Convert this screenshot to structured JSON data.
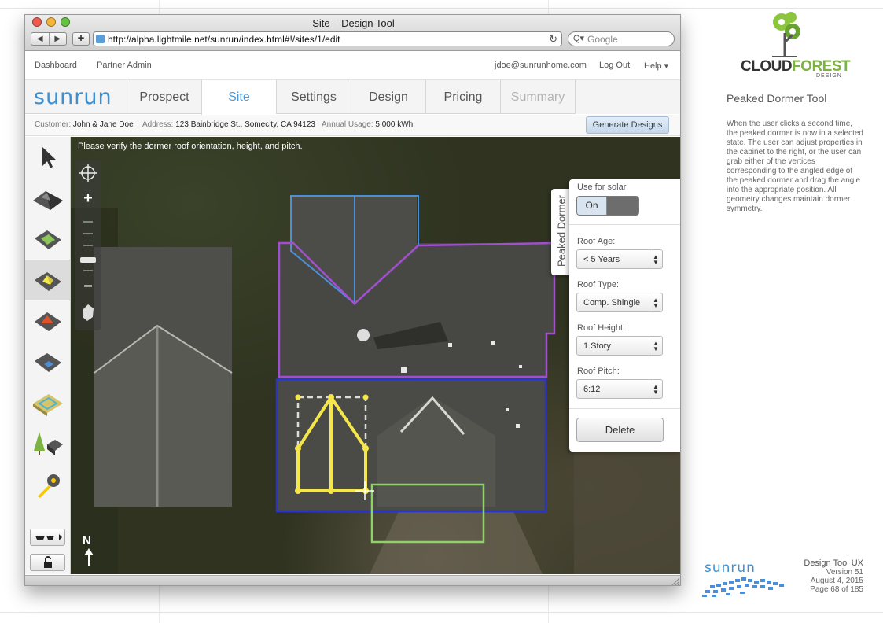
{
  "browser": {
    "title": "Site – Design Tool",
    "url": "http://alpha.lightmile.net/sunrun/index.html#!/sites/1/edit",
    "search_placeholder": "Google",
    "back_glyph": "◀",
    "forward_glyph": "▶",
    "add_glyph": "+",
    "reload_glyph": "↻",
    "search_glyph": "Q▾"
  },
  "usernav": {
    "dashboard": "Dashboard",
    "partner_admin": "Partner Admin",
    "email": "jdoe@sunrunhome.com",
    "logout": "Log Out",
    "help": "Help ▾"
  },
  "app": {
    "logo": "sunrun",
    "brand_color": "#3d8fd0",
    "tabs": [
      {
        "label": "Prospect"
      },
      {
        "label": "Site"
      },
      {
        "label": "Settings"
      },
      {
        "label": "Design"
      },
      {
        "label": "Pricing"
      },
      {
        "label": "Summary"
      }
    ],
    "active_tab": "Site",
    "disabled_tab": "Summary"
  },
  "info": {
    "customer_label": "Customer:",
    "customer_value": "John & Jane Doe",
    "address_label": "Address:",
    "address_value": "123 Bainbridge St., Somecity, CA 94123",
    "usage_label": "Annual Usage:",
    "usage_value": "5,000 kWh",
    "generate_button": "Generate Designs"
  },
  "toolbar": {
    "tools": [
      "pointer-icon",
      "peaked-roof-icon",
      "flat-roof-icon",
      "peaked-dormer-icon",
      "hip-roof-icon",
      "shed-dormer-icon",
      "flat-plane-icon",
      "tree-obstruction-icon",
      "tape-measure-icon"
    ],
    "selected_tool": "peaked-dormer-icon"
  },
  "map": {
    "message": "Please verify the dormer roof orientation, height, and pitch.",
    "north_label": "N",
    "zoom_in": "+",
    "zoom_out": "–"
  },
  "panel": {
    "tab_label": "Peaked Dormer",
    "use_for_solar_label": "Use for solar",
    "solar_toggle": "On",
    "roof_age_label": "Roof Age:",
    "roof_age_value": "< 5 Years",
    "roof_type_label": "Roof Type:",
    "roof_type_value": "Comp. Shingle",
    "roof_height_label": "Roof Height:",
    "roof_height_value": "1 Story",
    "roof_pitch_label": "Roof Pitch:",
    "roof_pitch_value": "6:12",
    "delete_button": "Delete",
    "select_arrows": "▲\n▼"
  },
  "annotation": {
    "logo_word_1": "CLOUD",
    "logo_word_2": "FOREST",
    "logo_sub": "DESIGN",
    "title": "Peaked Dormer Tool",
    "body": "When the user clicks a second time, the peaked dormer is now in a selected state. The user can adjust properties in the cabinet to the right, or the user can grab either of the vertices corresponding to the angled edge of the peaked dormer and drag the angle into the appropriate position. All geometry changes maintain dormer symmetry.",
    "footer_logo": "sunrun",
    "footer_doc": "Design Tool UX",
    "footer_version": "Version 51",
    "footer_date": "August 4, 2015",
    "footer_page": "Page 68 of 185"
  },
  "colors": {
    "dormer_highlight": "#f5e64a",
    "roof_outline_blue": "#4a8fd8",
    "roof_outline_purple": "#a14fd0",
    "roof_outline_navy": "#2a34c8",
    "roof_outline_green": "#8ed268"
  }
}
